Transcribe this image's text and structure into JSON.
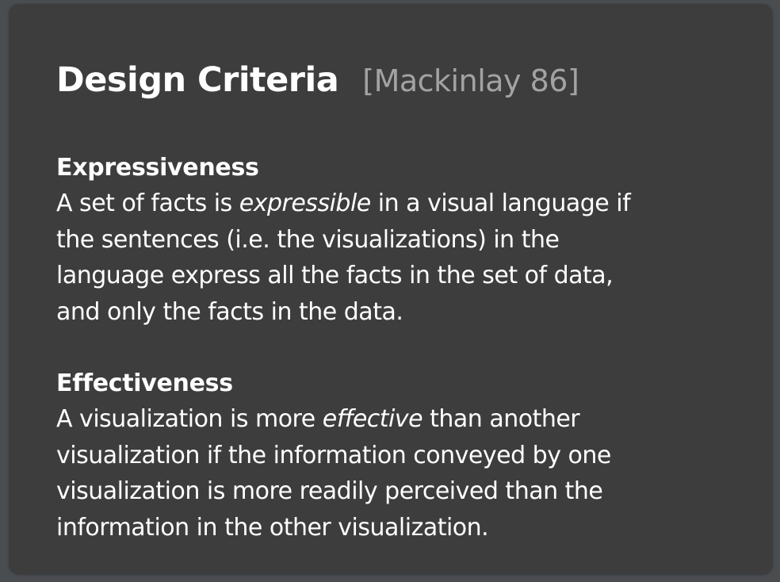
{
  "title": "Design Criteria",
  "citation": "[Mackinlay 86]",
  "sections": [
    {
      "heading": "Expressiveness",
      "lines": [
        {
          "pre": "A set of facts is ",
          "em": "expressible",
          "post": " in a visual language if"
        },
        {
          "text": "the sentences (i.e. the visualizations) in the"
        },
        {
          "text": "language express all the facts in the set of data,"
        },
        {
          "text": "and only the facts in the data."
        }
      ]
    },
    {
      "heading": "Effectiveness",
      "lines": [
        {
          "pre": "A visualization is more ",
          "em": "effective",
          "post": " than another"
        },
        {
          "text": "visualization if the information conveyed by one"
        },
        {
          "text": "visualization is more readily perceived than the"
        },
        {
          "text": "information in the other visualization."
        }
      ]
    }
  ]
}
